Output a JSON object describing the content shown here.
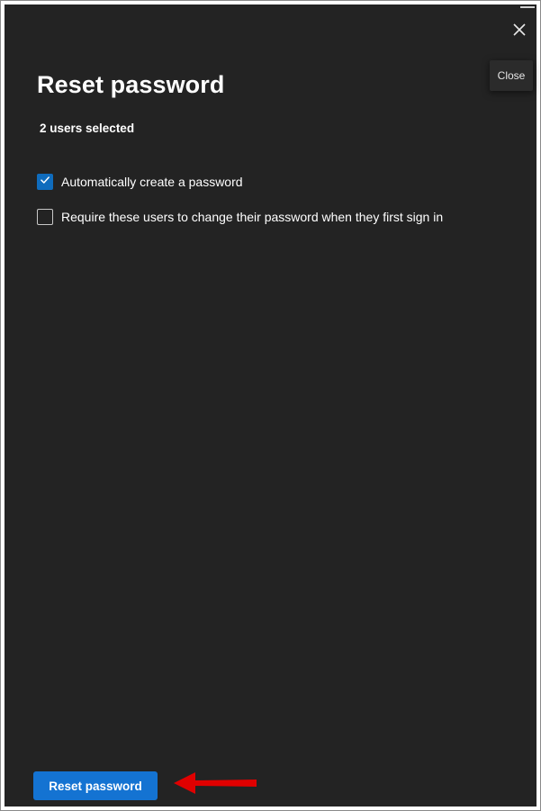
{
  "panel": {
    "title": "Reset password",
    "subtitle": "2 users selected",
    "close_tooltip": "Close"
  },
  "options": [
    {
      "label": "Automatically create a password",
      "checked": true
    },
    {
      "label": "Require these users to change their password when they first sign in",
      "checked": false
    }
  ],
  "footer": {
    "primary_label": "Reset password"
  },
  "colors": {
    "background": "#232323",
    "accent": "#1473d2",
    "checkbox_checked": "#0f6cbd",
    "annotation_arrow": "#e00000"
  },
  "icons": {
    "close": "close-icon",
    "check": "checkmark-icon",
    "annotation": "red-arrow-icon"
  }
}
